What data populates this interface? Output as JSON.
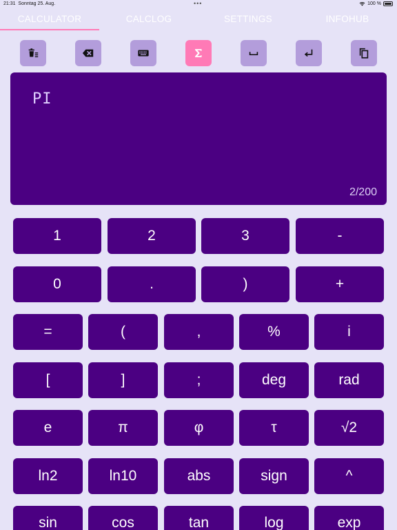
{
  "status_bar": {
    "time": "21:31",
    "date": "Sonntag 25. Aug.",
    "dots": "•••",
    "battery": "100 %"
  },
  "tabs": [
    {
      "label": "CALCULATOR",
      "active": true
    },
    {
      "label": "CALCLOG",
      "active": false
    },
    {
      "label": "SETTINGS",
      "active": false
    },
    {
      "label": "INFOHUB",
      "active": false
    }
  ],
  "toolbar": {
    "buttons": [
      "clear-all",
      "backspace",
      "keyboard",
      "sum",
      "space",
      "return",
      "copy"
    ],
    "active": "sum"
  },
  "display": {
    "expression": "PI",
    "char_count": "2/200"
  },
  "keypad": {
    "row1": [
      "1",
      "2",
      "3",
      "-"
    ],
    "row2": [
      "0",
      ".",
      ")",
      "+"
    ],
    "row3": [
      "=",
      "(",
      ",",
      "%",
      "i"
    ],
    "row4": [
      "[",
      "]",
      ";",
      "deg",
      "rad"
    ],
    "row5": [
      "e",
      "π",
      "φ",
      "τ",
      "√2"
    ],
    "row6": [
      "ln2",
      "ln10",
      "abs",
      "sign",
      "^"
    ],
    "row7": [
      "sin",
      "cos",
      "tan",
      "log",
      "exp"
    ]
  },
  "colors": {
    "background": "#e6e3f7",
    "key": "#4b0082",
    "toolbar_button": "#b39ddb",
    "accent": "#ff7ab6"
  }
}
